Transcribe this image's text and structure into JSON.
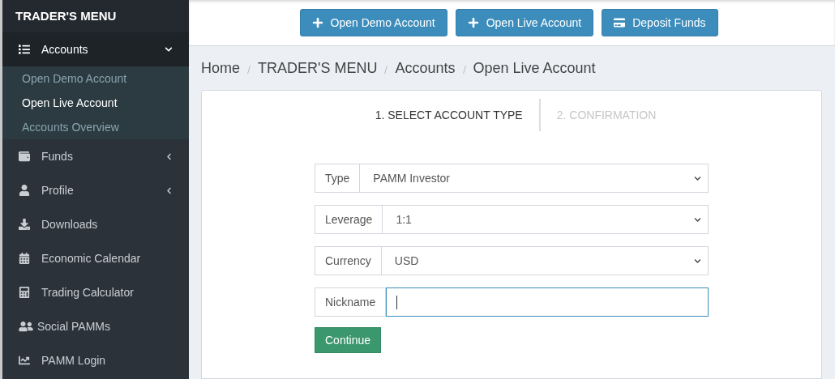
{
  "sidebar": {
    "title": "TRADER'S MENU",
    "items": [
      {
        "label": "Accounts",
        "expanded": true,
        "children": [
          {
            "label": "Open Demo Account",
            "selected": false
          },
          {
            "label": "Open Live Account",
            "selected": true
          },
          {
            "label": "Accounts Overview",
            "selected": false
          }
        ]
      },
      {
        "label": "Funds",
        "expanded": false
      },
      {
        "label": "Profile",
        "expanded": false
      },
      {
        "label": "Downloads"
      },
      {
        "label": "Economic Calendar"
      },
      {
        "label": "Trading Calculator"
      },
      {
        "label": "Social PAMMs"
      },
      {
        "label": "PAMM Login"
      }
    ]
  },
  "header_buttons": [
    "Open Demo Account",
    "Open Live Account",
    "Deposit Funds"
  ],
  "breadcrumb": [
    "Home",
    "TRADER'S MENU",
    "Accounts",
    "Open Live Account"
  ],
  "steps": [
    {
      "label": "1. SELECT ACCOUNT TYPE",
      "selected": true
    },
    {
      "label": "2. CONFIRMATION",
      "selected": false
    }
  ],
  "form": [
    {
      "kind": "select",
      "label": "Type",
      "value": "PAMM Investor"
    },
    {
      "kind": "select",
      "label": "Leverage",
      "value": "1:1"
    },
    {
      "kind": "select",
      "label": "Currency",
      "value": "USD"
    },
    {
      "kind": "input",
      "label": "Nickname",
      "focused": true
    }
  ],
  "submit": "Continue"
}
